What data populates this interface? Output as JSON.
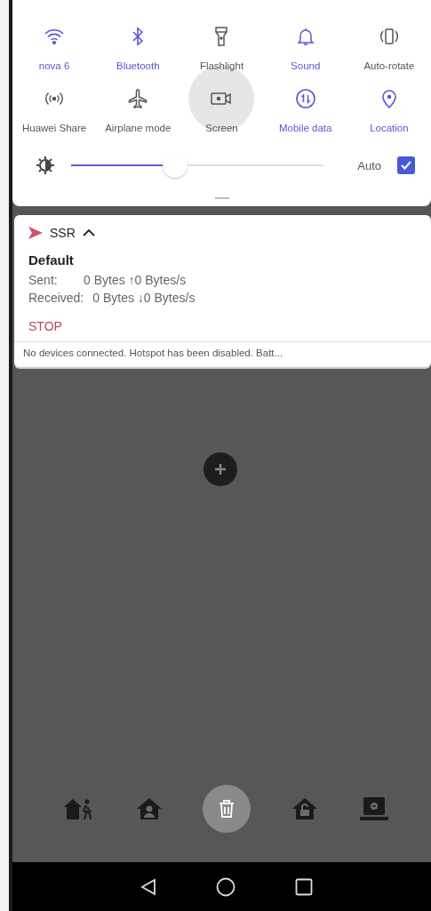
{
  "quick_settings": {
    "tiles": [
      {
        "kind": "wifi",
        "label": "nova 6",
        "on": true,
        "pressed": false
      },
      {
        "kind": "bluetooth",
        "label": "Bluetooth",
        "on": true,
        "pressed": false
      },
      {
        "kind": "flashlight",
        "label": "Flashlight",
        "on": false,
        "pressed": false
      },
      {
        "kind": "bell",
        "label": "Sound",
        "on": true,
        "pressed": false
      },
      {
        "kind": "rotate",
        "label": "Auto-rotate",
        "on": false,
        "pressed": false
      },
      {
        "kind": "share",
        "label": "Huawei Share",
        "on": false,
        "pressed": false
      },
      {
        "kind": "airplane",
        "label": "Airplane mode",
        "on": false,
        "pressed": false
      },
      {
        "kind": "recorder",
        "label": "Screen",
        "on": false,
        "pressed": true
      },
      {
        "kind": "data",
        "label": "Mobile data",
        "on": true,
        "pressed": false
      },
      {
        "kind": "location",
        "label": "Location",
        "on": true,
        "pressed": false
      }
    ],
    "brightness": {
      "level": 0.41,
      "auto_label": "Auto",
      "auto_checked": true
    }
  },
  "notification": {
    "app": "SSR",
    "expanded": true,
    "title": "Default",
    "lines": [
      {
        "label": "Sent:",
        "value": "0 Bytes ↑0 Bytes/s"
      },
      {
        "label": "Received:",
        "value": "0 Bytes ↓0 Bytes/s"
      }
    ],
    "action": "STOP"
  },
  "hidden_notification": "No devices connected. Hotspot has been disabled. Batt...",
  "dock": [
    {
      "kind": "house-walker",
      "selected": false
    },
    {
      "kind": "house-person",
      "selected": false
    },
    {
      "kind": "trash",
      "selected": true
    },
    {
      "kind": "house-lock",
      "selected": false
    },
    {
      "kind": "monitor",
      "selected": false
    }
  ]
}
